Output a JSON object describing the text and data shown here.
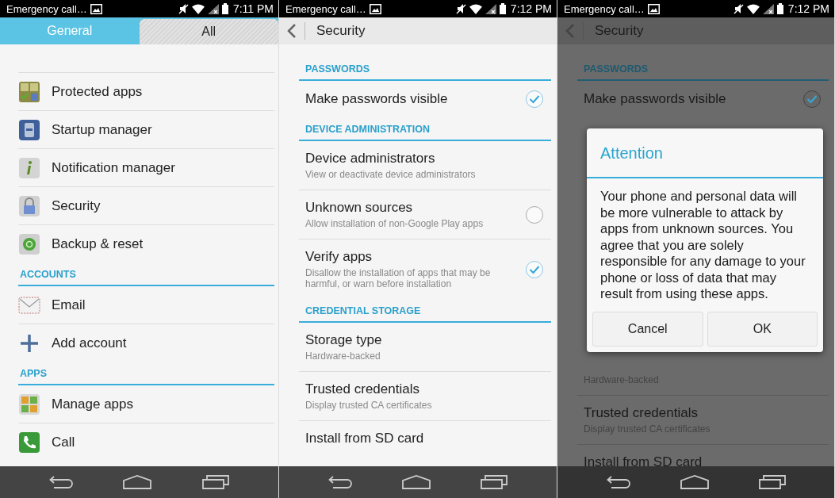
{
  "screens": [
    {
      "status_bar": {
        "notification": "Emergency call…",
        "time": "7:11 PM"
      },
      "dimmed": false,
      "header": {
        "kind": "tabs",
        "tabs": [
          {
            "label": "General",
            "selected": true
          },
          {
            "label": "All",
            "selected": false
          }
        ]
      },
      "list": [
        {
          "kind": "app",
          "title": "Protected apps"
        },
        {
          "kind": "app",
          "title": "Startup manager"
        },
        {
          "kind": "app",
          "title": "Notification manager"
        },
        {
          "kind": "app",
          "title": "Security"
        },
        {
          "kind": "app",
          "title": "Backup & reset"
        },
        {
          "kind": "section",
          "title": "ACCOUNTS"
        },
        {
          "kind": "app",
          "title": "Email"
        },
        {
          "kind": "app",
          "title": "Add account"
        },
        {
          "kind": "section",
          "title": "APPS"
        },
        {
          "kind": "app",
          "title": "Manage apps"
        },
        {
          "kind": "app",
          "title": "Call"
        }
      ]
    },
    {
      "status_bar": {
        "notification": "Emergency call…",
        "time": "7:12 PM"
      },
      "dimmed": false,
      "header": {
        "kind": "title",
        "title": "Security"
      },
      "list": [
        {
          "kind": "section",
          "title": "PASSWORDS"
        },
        {
          "kind": "setting",
          "title": "Make passwords visible",
          "checked": true
        },
        {
          "kind": "section",
          "title": "DEVICE ADMINISTRATION"
        },
        {
          "kind": "setting",
          "title": "Device administrators",
          "subtitle": "View or deactivate device administrators"
        },
        {
          "kind": "setting",
          "title": "Unknown sources",
          "subtitle": "Allow installation of non-Google Play apps",
          "checked": false
        },
        {
          "kind": "setting",
          "title": "Verify apps",
          "subtitle": "Disallow the installation of apps that may be harmful, or warn before installation",
          "checked": true
        },
        {
          "kind": "section",
          "title": "CREDENTIAL STORAGE"
        },
        {
          "kind": "setting",
          "title": "Storage type",
          "subtitle": "Hardware-backed"
        },
        {
          "kind": "setting",
          "title": "Trusted credentials",
          "subtitle": "Display trusted CA certificates"
        },
        {
          "kind": "setting",
          "title": "Install from SD card"
        }
      ]
    },
    {
      "status_bar": {
        "notification": "Emergency call…",
        "time": "7:12 PM"
      },
      "dimmed": true,
      "header": {
        "kind": "title",
        "title": "Security"
      },
      "list": [
        {
          "kind": "section",
          "title": "PASSWORDS"
        },
        {
          "kind": "setting",
          "title": "Make passwords visible",
          "checked": true
        },
        {
          "kind": "setting",
          "subtitle": "Hardware-backed"
        },
        {
          "kind": "setting",
          "title": "Trusted credentials",
          "subtitle": "Display trusted CA certificates"
        },
        {
          "kind": "setting",
          "title": "Install from SD card"
        }
      ],
      "dialog": {
        "title": "Attention",
        "message": "Your phone and personal data will be more vulnerable to attack by apps from unknown sources. You agree that you are solely responsible for any damage to your phone or loss of data that may result from using these apps.",
        "buttons": [
          "Cancel",
          "OK"
        ]
      }
    }
  ]
}
